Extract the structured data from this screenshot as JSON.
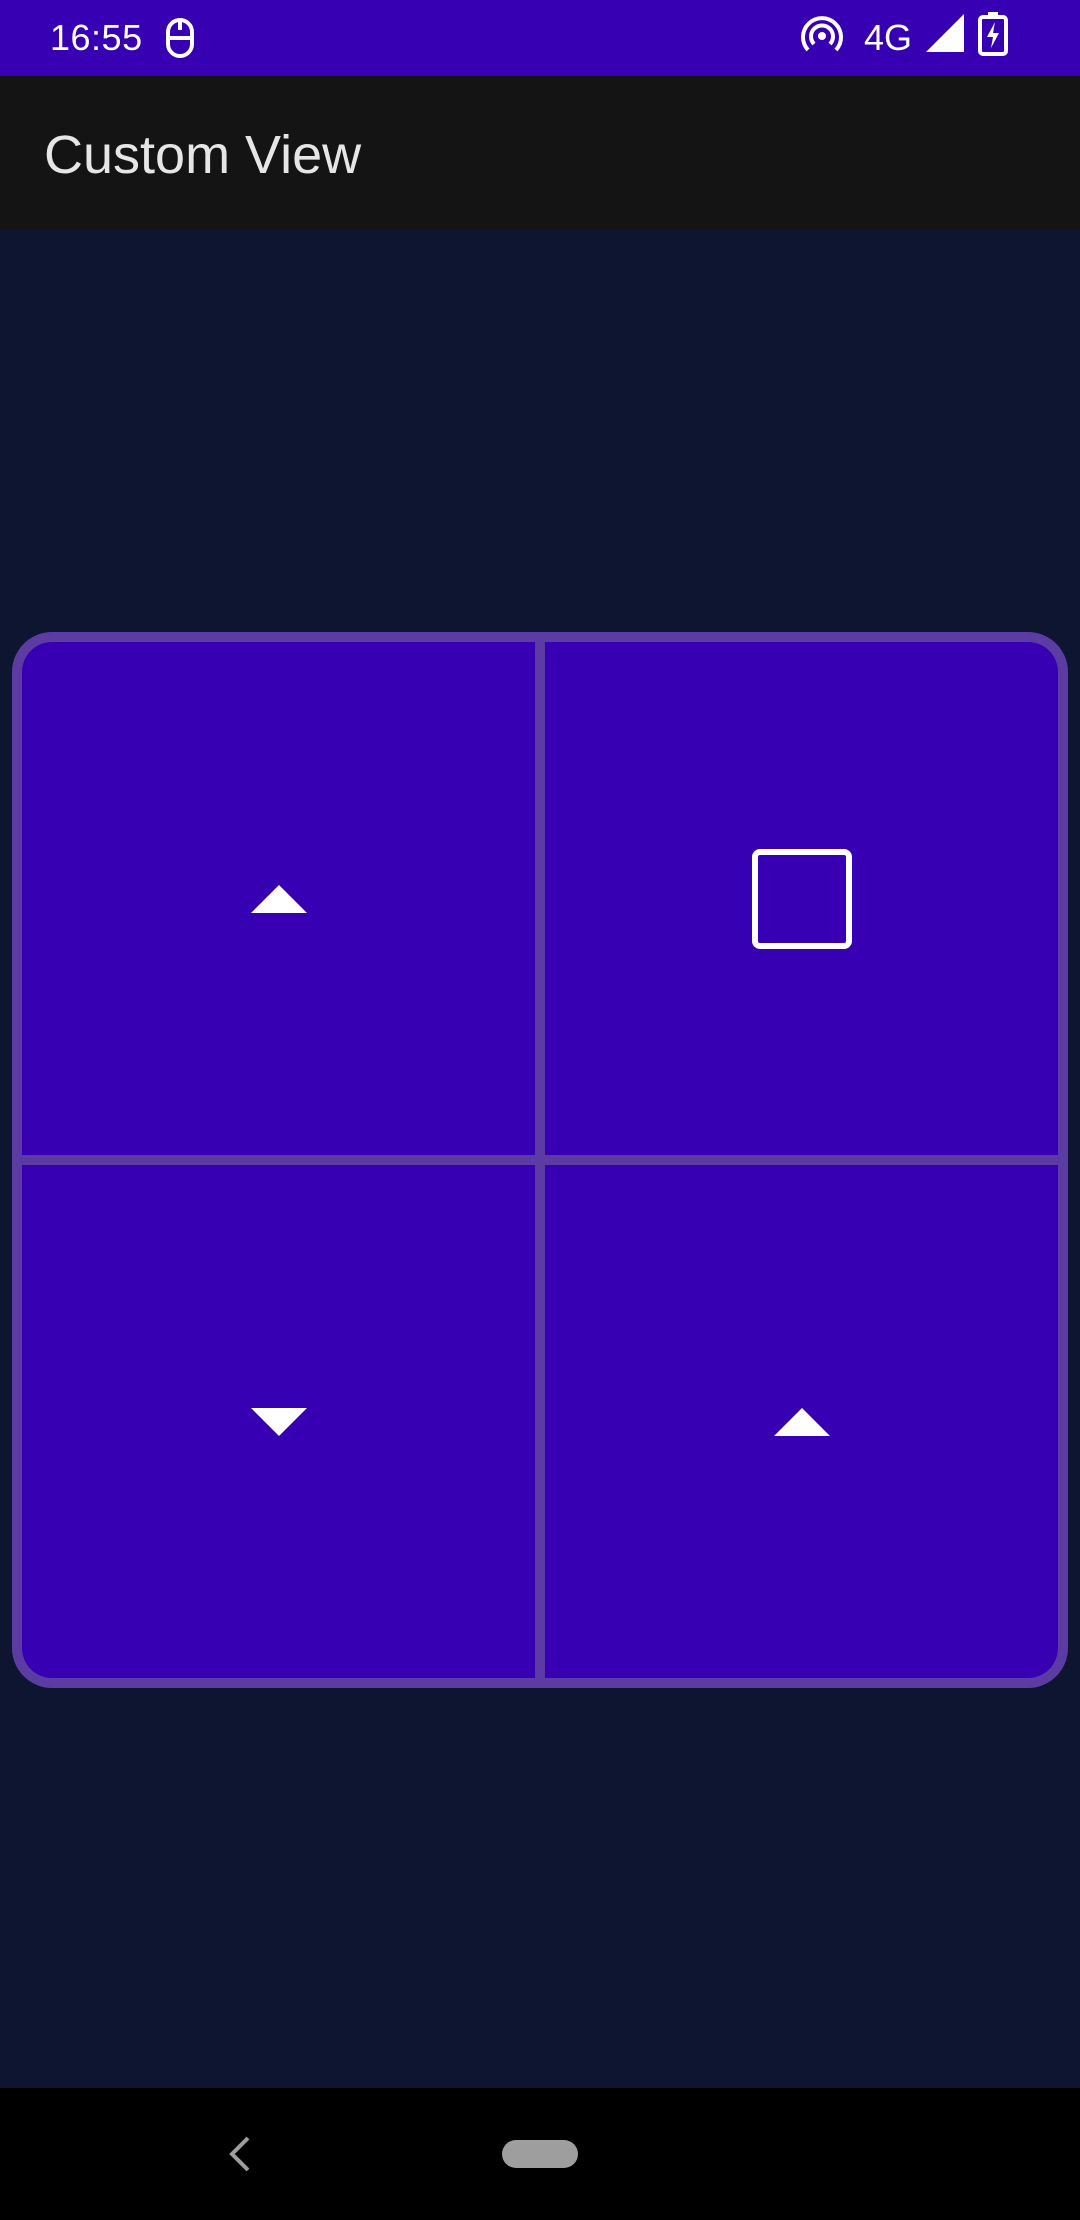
{
  "status_bar": {
    "time": "16:55",
    "left_icon": "media-icon",
    "hotspot_icon": "hotspot-icon",
    "network": "4G",
    "signal_icon": "signal-icon",
    "battery_icon": "battery-charging-icon",
    "background_color": "#3700b3"
  },
  "app_bar": {
    "title": "Custom View",
    "background_color": "#141414"
  },
  "control_pad": {
    "button_color": "#3700b3",
    "border_color": "#5c3ca3",
    "buttons": [
      {
        "id": "top-left",
        "icon": "triangle-up-icon"
      },
      {
        "id": "top-right",
        "icon": "square-icon"
      },
      {
        "id": "bottom-left",
        "icon": "triangle-down-icon"
      },
      {
        "id": "bottom-right",
        "icon": "triangle-up-icon"
      }
    ]
  },
  "nav_bar": {
    "back_icon": "back-chevron-icon",
    "home_icon": "home-pill-icon"
  }
}
